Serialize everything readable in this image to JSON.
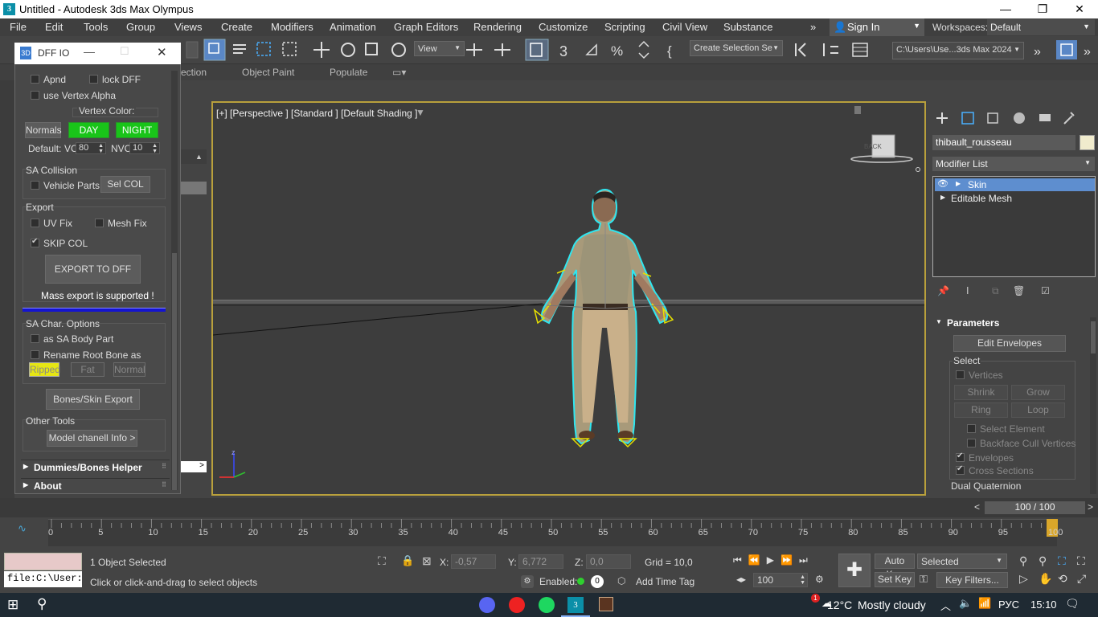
{
  "window": {
    "app_title": "Untitled - Autodesk 3ds Max Olympus",
    "icon_letter": "3"
  },
  "menu": [
    "File",
    "Edit",
    "Tools",
    "Group",
    "Views",
    "Create",
    "Modifiers",
    "Animation",
    "Graph Editors",
    "Rendering",
    "Customize",
    "Scripting",
    "Civil View",
    "Substance"
  ],
  "account": {
    "sign_in": "Sign In",
    "workspaces_label": "Workspaces:",
    "workspace": "Default"
  },
  "toolbar": {
    "view_drop": "View",
    "selection_set": "Create Selection Se",
    "project_path": "C:\\Users\\Use...3ds Max 2024"
  },
  "ribbon": {
    "tabs": [
      "ection",
      "Object Paint",
      "Populate"
    ]
  },
  "dff_io": {
    "title": "DFF IO",
    "apnd": "Apnd",
    "lock_dff": "lock DFF",
    "use_vertex_alpha": "use Vertex Alpha",
    "vertex_color": "Vertex Color:",
    "normals": "Normals",
    "day": "DAY",
    "night": "NIGHT",
    "default_label": "Default:",
    "vc_label": "VC",
    "vc_value": "80",
    "nvc_label": "NVC",
    "nvc_value": "10",
    "sa_collision": "SA Collision",
    "vehicle_parts": "Vehicle Parts",
    "sel_col": "Sel COL",
    "export": "Export",
    "uv_fix": "UV Fix",
    "mesh_fix": "Mesh Fix",
    "skip_col": "SKIP COL",
    "export_to_dff": "EXPORT TO DFF",
    "mass_export": "Mass export is supported !",
    "sa_char_options": "SA Char. Options",
    "as_sa_body_part": "as SA Body Part",
    "rename_root_bone": "Rename Root Bone as",
    "ripped": "Ripped",
    "fat": "Fat",
    "normal": "Normal",
    "bones_skin_export": "Bones/Skin Export",
    "other_tools": "Other Tools",
    "model_channel_info": "Model chanell Info >",
    "dummies_bones_helper": "Dummies/Bones Helper",
    "about": "About"
  },
  "viewport": {
    "label": "[+] [Perspective ] [Standard ] [Default Shading ]",
    "viewcube": "BACK",
    "axis_z": "z"
  },
  "command_panel": {
    "object_name": "thibault_rousseau",
    "modifier_list": "Modifier List",
    "stack": [
      "Skin",
      "Editable Mesh"
    ],
    "parameters": "Parameters",
    "edit_envelopes": "Edit Envelopes",
    "select": "Select",
    "vertices": "Vertices",
    "shrink": "Shrink",
    "grow": "Grow",
    "ring": "Ring",
    "loop": "Loop",
    "select_element": "Select Element",
    "backface_cull": "Backface Cull Vertices",
    "envelopes": "Envelopes",
    "cross_sections": "Cross Sections",
    "dual_quaternion": "Dual Quaternion",
    "accent": "#5e8ecf"
  },
  "timeline": {
    "frame_display": "100 / 100",
    "ticks": [
      "0",
      "5",
      "10",
      "15",
      "20",
      "25",
      "30",
      "35",
      "40",
      "45",
      "50",
      "55",
      "60",
      "65",
      "70",
      "75",
      "80",
      "85",
      "90",
      "95",
      "100"
    ]
  },
  "status": {
    "selected_count": "1 Object Selected",
    "prompt": "Click or click-and-drag to select objects",
    "maxscript_input": "file:C:\\User:",
    "x_label": "X:",
    "x_value": "-0,57",
    "y_label": "Y:",
    "y_value": "6,772",
    "z_label": "Z:",
    "z_value": "0,0",
    "grid": "Grid = 10,0",
    "enabled": "Enabled:",
    "add_time_tag": "Add Time Tag",
    "frame_input": "100",
    "auto_key": "Auto Key",
    "set_key": "Set Key",
    "selected_drop": "Selected",
    "key_filters": "Key Filters..."
  },
  "taskbar": {
    "temperature": "12°C",
    "weather": "Mostly cloudy",
    "language": "РУС",
    "time": "15:10",
    "notification_count": "1"
  }
}
